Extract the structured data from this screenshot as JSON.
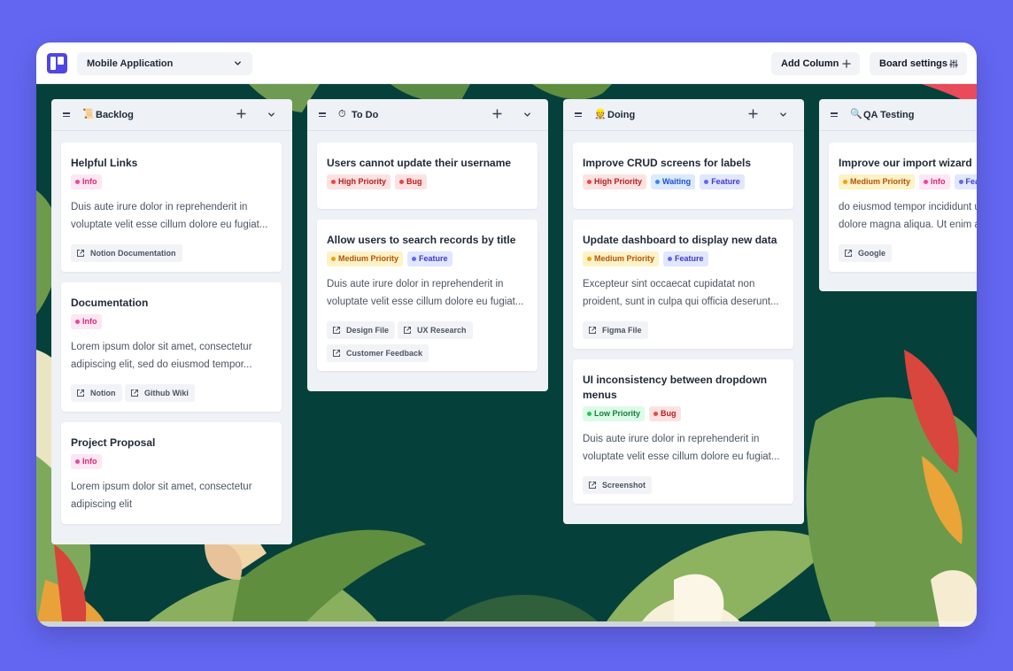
{
  "header": {
    "board_name": "Mobile Application",
    "add_column_label": "Add Column",
    "board_settings_label": "Board settings"
  },
  "columns": [
    {
      "emoji": "📜",
      "title": "Backlog",
      "cards": [
        {
          "title": "Helpful Links",
          "tags": [
            "Info"
          ],
          "desc": [
            "Duis aute irure dolor in reprehenderit in",
            "voluptate velit esse cillum dolore eu fugiat..."
          ],
          "links": [
            "Notion Documentation"
          ]
        },
        {
          "title": "Documentation",
          "tags": [
            "Info"
          ],
          "desc": [
            "Lorem ipsum dolor sit amet, consectetur",
            "adipiscing elit, sed do eiusmod tempor..."
          ],
          "links": [
            "Notion",
            "Github Wiki"
          ]
        },
        {
          "title": "Project Proposal",
          "tags": [
            "Info"
          ],
          "desc": [
            "Lorem ipsum dolor sit amet, consectetur",
            "adipiscing elit"
          ],
          "links": []
        }
      ]
    },
    {
      "emoji": "⏱",
      "title": "To Do",
      "cards": [
        {
          "title": "Users cannot update their username",
          "tags": [
            "High Priority",
            "Bug"
          ],
          "desc": [],
          "links": []
        },
        {
          "title": "Allow users to search records by title",
          "tags": [
            "Medium Priority",
            "Feature"
          ],
          "desc": [
            "Duis aute irure dolor in reprehenderit in",
            "voluptate velit esse cillum dolore eu fugiat..."
          ],
          "links": [
            "Design File",
            "UX Research",
            "Customer Feedback"
          ]
        }
      ]
    },
    {
      "emoji": "👷",
      "title": "Doing",
      "cards": [
        {
          "title": "Improve CRUD screens for labels",
          "tags": [
            "High Priority",
            "Waiting",
            "Feature"
          ],
          "desc": [],
          "links": []
        },
        {
          "title": "Update dashboard to display new data",
          "tags": [
            "Medium Priority",
            "Feature"
          ],
          "desc": [
            "Excepteur sint occaecat cupidatat non",
            "proident, sunt in culpa qui officia deserunt..."
          ],
          "links": [
            "Figma File"
          ]
        },
        {
          "title": "UI inconsistency between dropdown menus",
          "tags": [
            "Low Priority",
            "Bug"
          ],
          "desc": [
            "Duis aute irure dolor in reprehenderit in",
            "voluptate velit esse cillum dolore eu fugiat..."
          ],
          "links": [
            "Screenshot"
          ]
        }
      ]
    },
    {
      "emoji": "🔍",
      "title": "QA Testing",
      "cards": [
        {
          "title": "Improve our import wizard",
          "tags": [
            "Medium Priority",
            "Info",
            "Feature"
          ],
          "desc": [
            "do eiusmod tempor incididunt ut labore et",
            "dolore magna aliqua. Ut enim ad minim"
          ],
          "links": [
            "Google"
          ]
        }
      ]
    }
  ],
  "colors": {
    "page_bg": "#6366f1",
    "board_bg": "#06403a",
    "brand": "#4f46e5"
  }
}
